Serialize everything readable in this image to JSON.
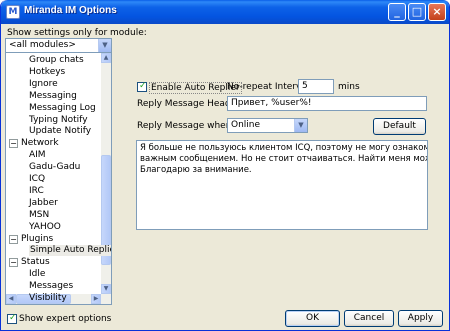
{
  "window": {
    "title": "Miranda IM Options",
    "controls": [
      "minimize-icon",
      "maximize-icon",
      "close-icon"
    ]
  },
  "module_filter": {
    "label": "Show settings only for module:",
    "selected": "<all modules>"
  },
  "tree": [
    {
      "label": "Group chats",
      "level": 1
    },
    {
      "label": "Hotkeys",
      "level": 1
    },
    {
      "label": "Ignore",
      "level": 1
    },
    {
      "label": "Messaging",
      "level": 1
    },
    {
      "label": "Messaging Log",
      "level": 1
    },
    {
      "label": "Typing Notify",
      "level": 1
    },
    {
      "label": "Update Notify",
      "level": 1
    },
    {
      "label": "Network",
      "level": 0,
      "expanded": true
    },
    {
      "label": "AIM",
      "level": 1
    },
    {
      "label": "Gadu-Gadu",
      "level": 1
    },
    {
      "label": "ICQ",
      "level": 1
    },
    {
      "label": "IRC",
      "level": 1
    },
    {
      "label": "Jabber",
      "level": 1
    },
    {
      "label": "MSN",
      "level": 1
    },
    {
      "label": "YAHOO",
      "level": 1
    },
    {
      "label": "Plugins",
      "level": 0,
      "expanded": true
    },
    {
      "label": "Simple Auto Replier",
      "level": 1,
      "selected": true
    },
    {
      "label": "Status",
      "level": 0,
      "expanded": true
    },
    {
      "label": "Idle",
      "level": 1
    },
    {
      "label": "Messages",
      "level": 1
    },
    {
      "label": "Visibility",
      "level": 1
    }
  ],
  "show_expert": {
    "label": "Show expert options",
    "checked": true
  },
  "auto_replier": {
    "enable_label": "Enable Auto Replier",
    "enabled": true,
    "no_repeat_label": "No-repeat Interval:",
    "no_repeat_value": "5",
    "no_repeat_unit": "mins",
    "heading_label": "Reply Message Heading:",
    "heading_value": "Привет, %user%!",
    "when_label": "Reply Message when",
    "when_value": "Online",
    "default_button": "Default",
    "message_lines": [
      "Я больше не пользуюсь клиентом ICQ, поэтому не могу ознакомиться с вашим,",
      "важным сообщением. Но не стоит отчаиваться. Найти меня можно в сети Jabbe",
      "Благодарю за внимание."
    ]
  },
  "buttons": {
    "ok": "OK",
    "cancel": "Cancel",
    "apply": "Apply"
  }
}
